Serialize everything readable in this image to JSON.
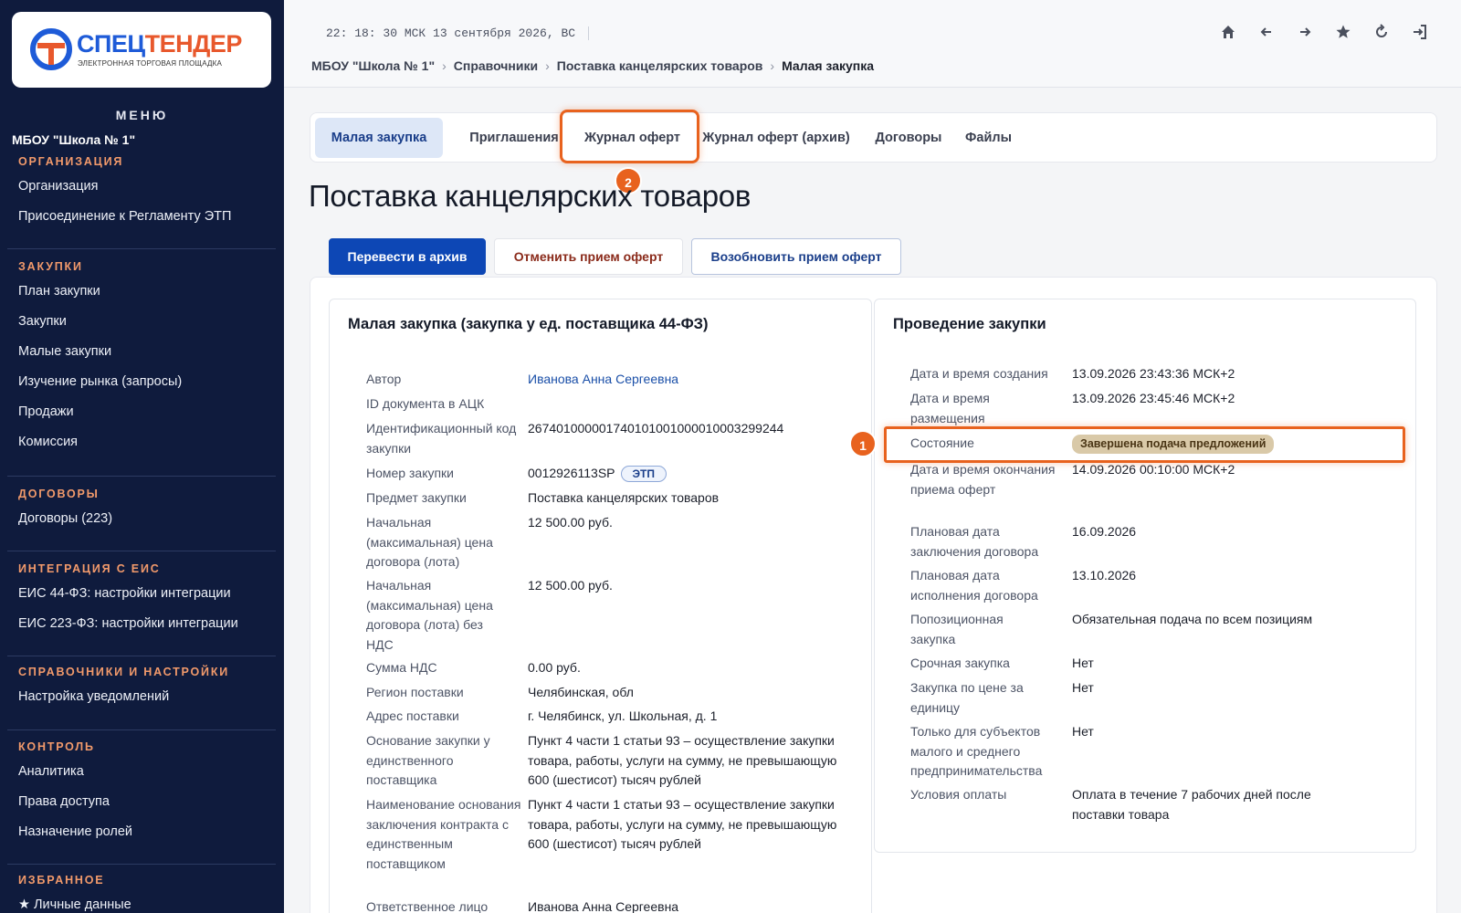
{
  "logo": {
    "brand_a": "СПЕЦ",
    "brand_b": "ТЕНДЕР",
    "tagline": "ЭЛЕКТРОННАЯ ТОРГОВАЯ ПЛОЩАДКА",
    "colors": {
      "blue": "#1e5bd8",
      "orange": "#e8582c"
    }
  },
  "sidebar": {
    "menu_title": "МЕНЮ",
    "org_name": "МБОУ \"Школа № 1\"",
    "sections": [
      {
        "heading": "ОРГАНИЗАЦИЯ",
        "items": [
          "Организация",
          "Присоединение к Регламенту ЭТП"
        ]
      },
      {
        "heading": "ЗАКУПКИ",
        "items": [
          "План закупки",
          "Закупки",
          "Малые закупки",
          "Изучение рынка (запросы)",
          "Продажи",
          "Комиссия"
        ]
      },
      {
        "heading": "ДОГОВОРЫ",
        "items": [
          "Договоры (223)"
        ]
      },
      {
        "heading": "ИНТЕГРАЦИЯ С ЕИС",
        "items": [
          "ЕИС 44-ФЗ: настройки интеграции",
          "ЕИС 223-ФЗ: настройки интеграции"
        ]
      },
      {
        "heading": "СПРАВОЧНИКИ И НАСТРОЙКИ",
        "items": [
          "Настройка уведомлений"
        ]
      },
      {
        "heading": "КОНТРОЛЬ",
        "items": [
          "Аналитика",
          "Права доступа",
          "Назначение ролей"
        ]
      },
      {
        "heading": "ИЗБРАННОЕ",
        "items": [
          "★ Личные данные"
        ]
      }
    ]
  },
  "topbar": {
    "clock": "22: 18: 30 МСК  13 сентября 2026, ВС",
    "breadcrumb": [
      "МБОУ \"Школа № 1\"",
      "Справочники",
      "Поставка канцелярских товаров"
    ],
    "breadcrumb_current": "Малая закупка",
    "icons": [
      "home-icon",
      "arrow-left-icon",
      "arrow-right-icon",
      "star-icon",
      "refresh-icon",
      "logout-icon"
    ]
  },
  "tabs": [
    "Малая закупка",
    "Приглашения",
    "Журнал оферт",
    "Журнал оферт (архив)",
    "Договоры",
    "Файлы"
  ],
  "callouts": {
    "one": "1",
    "two": "2"
  },
  "page_title": "Поставка канцелярских товаров",
  "actions": {
    "archive": "Перевести в архив",
    "cancel": "Отменить прием оферт",
    "resume": "Возобновить прием оферт"
  },
  "left_card": {
    "title": "Малая закупка (закупка у ед. поставщика 44-ФЗ)",
    "rows": [
      {
        "k": "Автор",
        "v": "Иванова Анна Сергеевна"
      },
      {
        "k": "ID документа в АЦК",
        "v": ""
      },
      {
        "k": "Идентификационный код закупки",
        "v": "26740100000174010100100001000329924​4"
      },
      {
        "k": "Номер закупки",
        "v": "0012926113SP",
        "tag": "ЭТП"
      },
      {
        "k": "Предмет закупки",
        "v": "Поставка канцелярских товаров"
      },
      {
        "k": "Начальная (максимальная) цена договора (лота)",
        "v": "12 500.00 руб."
      },
      {
        "k": "Начальная (максимальная) цена договора (лота) без НДС",
        "v": "12 500.00 руб."
      },
      {
        "k": "Сумма НДС",
        "v": "0.00 руб."
      },
      {
        "k": "Регион поставки",
        "v": "Челябинская, обл"
      },
      {
        "k": "Адрес поставки",
        "v": "г. Челябинск, ул. Школьная, д. 1"
      },
      {
        "k": "Основание закупки у единственного поставщика",
        "v": "Пункт 4 части 1 статьи 93 – осуществление закупки товара, работы, услуги на сумму, не превышающую 600 (шестисот) тысяч рублей"
      },
      {
        "k": "Наименование основания заключения контракта с единственным поставщиком",
        "v": "Пункт 4 части 1 статьи 93 – осуществление закупки товара, работы, услуги на сумму, не превышающую 600 (шестисот) тысяч рублей"
      },
      {
        "k": "Ответственное лицо",
        "v": "Иванова Анна Сергеевна"
      }
    ]
  },
  "right_card": {
    "title": "Проведение закупки",
    "rows": [
      {
        "k": "Дата и время создания",
        "v": "13.09.2026 23:43:36 МСК+2"
      },
      {
        "k": "Дата и время размещения",
        "v": "13.09.2026 23:45:46 МСК+2"
      },
      {
        "k": "Состояние",
        "v": "Завершена подача предложений"
      },
      {
        "k": "Дата и время окончания приема оферт",
        "v": "14.09.2026 00:10:00 МСК+2"
      },
      {
        "k": "Плановая дата заключения договора",
        "v": "16.09.2026"
      },
      {
        "k": "Плановая дата исполнения договора",
        "v": "13.10.2026"
      },
      {
        "k": "Попозиционная закупка",
        "v": "Обязательная подача по всем позициям"
      },
      {
        "k": "Срочная закупка",
        "v": "Нет"
      },
      {
        "k": "Закупка по цене за единицу",
        "v": "Нет"
      },
      {
        "k": "Только для субъектов малого и среднего предпринимательства",
        "v": "Нет"
      },
      {
        "k": "Условия оплаты",
        "v": "Оплата в течение 7 рабочих дней после поставки товара"
      }
    ]
  }
}
